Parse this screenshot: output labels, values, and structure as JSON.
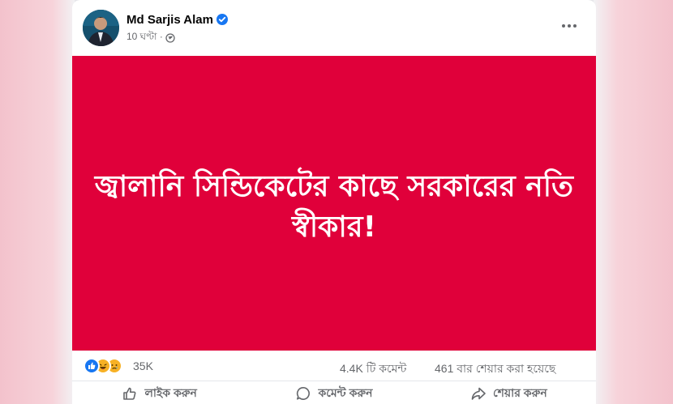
{
  "post": {
    "author_name": "Md Sarjis Alam",
    "timestamp": "10 ঘণ্টা ·",
    "image_text": "জ্বালানি সিন্ডিকেটের কাছে সরকারের নতি স্বীকার!",
    "image_color": "#e0003a"
  },
  "stats": {
    "reactions": "35K",
    "comments": "4.4K টি কমেন্ট",
    "shares": "461 বার শেয়ার করা হয়েছে"
  },
  "actions": {
    "like": "লাইক করুন",
    "comment": "কমেন্ট করুন",
    "share": "শেয়ার করুন"
  },
  "icons": [
    "verified-icon",
    "globe-icon",
    "more-icon",
    "like-reaction-icon",
    "haha-reaction-icon",
    "sad-reaction-icon",
    "thumbs-up-icon",
    "comment-icon",
    "share-icon"
  ],
  "colors": {
    "accent": "#1877f2",
    "text_secondary": "#65676b"
  }
}
